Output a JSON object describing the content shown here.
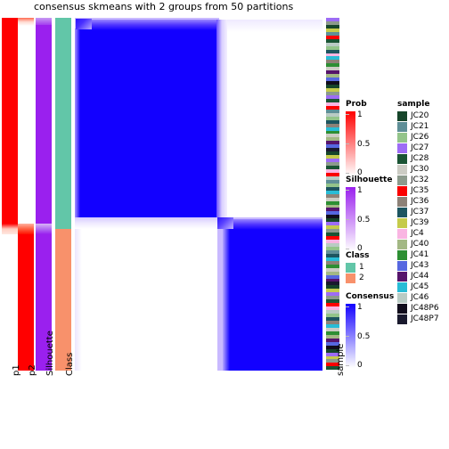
{
  "title": "consensus skmeans with 2 groups from 50 partitions",
  "axis_labels": {
    "p1": "p1",
    "p2": "p2",
    "silhouette": "Silhouette",
    "class": "Class",
    "sample": "sample"
  },
  "legends": {
    "prob": {
      "title": "Prob",
      "type": "gradient",
      "ticks": [
        "1",
        "0.5",
        "0"
      ],
      "high_color": "#ff0000",
      "low_color": "#ffffff"
    },
    "silhouette": {
      "title": "Silhouette",
      "type": "gradient",
      "ticks": [
        "1",
        "0.5",
        "0"
      ],
      "high_color": "#9a20ee",
      "low_color": "#ffffff"
    },
    "class": {
      "title": "Class",
      "type": "discrete",
      "items": [
        {
          "label": "1",
          "color": "#62c6a8"
        },
        {
          "label": "2",
          "color": "#f8916b"
        }
      ]
    },
    "consensus": {
      "title": "Consensus",
      "type": "gradient",
      "ticks": [
        "1",
        "0.5",
        "0"
      ],
      "high_color": "#1200ff",
      "low_color": "#ffffff"
    },
    "sample": {
      "title": "sample",
      "type": "discrete",
      "items": [
        {
          "label": "JC20",
          "color": "#16452a"
        },
        {
          "label": "JC21",
          "color": "#5f8f97"
        },
        {
          "label": "JC26",
          "color": "#93c48a"
        },
        {
          "label": "JC27",
          "color": "#9d6cf5"
        },
        {
          "label": "JC28",
          "color": "#1a5434"
        },
        {
          "label": "JC30",
          "color": "#ccccc4"
        },
        {
          "label": "JC32",
          "color": "#8c9a8c"
        },
        {
          "label": "JC35",
          "color": "#fa0000"
        },
        {
          "label": "JC36",
          "color": "#8d8177"
        },
        {
          "label": "JC37",
          "color": "#1d5560"
        },
        {
          "label": "JC39",
          "color": "#c5cb4b"
        },
        {
          "label": "JC4",
          "color": "#f9b5e2"
        },
        {
          "label": "JC40",
          "color": "#a3b884"
        },
        {
          "label": "JC41",
          "color": "#2d8f33"
        },
        {
          "label": "JC43",
          "color": "#5667e0"
        },
        {
          "label": "JC44",
          "color": "#56146b"
        },
        {
          "label": "JC45",
          "color": "#28bcd6"
        },
        {
          "label": "JC46",
          "color": "#b9cbc4"
        },
        {
          "label": "JC48P6",
          "color": "#110d1c"
        },
        {
          "label": "JC48P7",
          "color": "#1a1a2e"
        }
      ]
    }
  },
  "chart_data": {
    "type": "heatmap",
    "title": "consensus skmeans with 2 groups from 50 partitions",
    "description": "Consensus matrix from skmeans clustering with k=2 over 50 partitions; two diagonal blocks of consensus 1 (blue) with off-diagonal consensus 0 (white).",
    "n_groups": 2,
    "n_partitions": 50,
    "method": "skmeans",
    "value_range": [
      0,
      1
    ],
    "group_split_fraction": 0.6,
    "blocks": [
      {
        "group": 1,
        "row_start": 0.0,
        "row_end": 0.6,
        "col_start": 0.0,
        "col_end": 0.6,
        "value": 1
      },
      {
        "group": 1,
        "row_start": 0.0,
        "row_end": 0.6,
        "col_start": 0.6,
        "col_end": 1.0,
        "value": 0
      },
      {
        "group": 2,
        "row_start": 0.6,
        "row_end": 1.0,
        "col_start": 0.0,
        "col_end": 0.6,
        "value": 0
      },
      {
        "group": 2,
        "row_start": 0.6,
        "row_end": 1.0,
        "col_start": 0.6,
        "col_end": 1.0,
        "value": 1
      }
    ],
    "annotations": {
      "p1": {
        "top_block": 1,
        "bottom_block": 0,
        "colors": [
          "#ff0000",
          "#ffffff"
        ]
      },
      "p2": {
        "top_block": 0,
        "bottom_block": 1,
        "colors": [
          "#ffffff",
          "#ff0000"
        ]
      },
      "silhouette": {
        "top_block": 1,
        "bottom_block": 1,
        "color": "#9a20ee"
      },
      "class": {
        "top_block": 1,
        "bottom_block": 2,
        "colors": [
          "#62c6a8",
          "#f8916b"
        ]
      }
    },
    "sample_strip_colors": [
      "#9d6cf5",
      "#8c9a8c",
      "#16452a",
      "#c5cb4b",
      "#5f8f97",
      "#fa0000",
      "#1a5434",
      "#b9cbc4",
      "#93c48a",
      "#1d5560",
      "#f9b5e2",
      "#28bcd6",
      "#8d8177",
      "#2d8f33",
      "#ccccc4",
      "#56146b",
      "#a3b884",
      "#5667e0",
      "#110d1c",
      "#16452a",
      "#c5cb4b",
      "#8c9a8c",
      "#9d6cf5",
      "#1a5434",
      "#f9b5e2",
      "#fa0000",
      "#5f8f97",
      "#b9cbc4",
      "#93c48a",
      "#1d5560",
      "#8d8177",
      "#28bcd6",
      "#2d8f33",
      "#ccccc4",
      "#a3b884",
      "#56146b",
      "#5667e0",
      "#1a1a2e",
      "#16452a",
      "#c5cb4b",
      "#9d6cf5",
      "#8c9a8c",
      "#1a5434",
      "#f9b5e2",
      "#fa0000",
      "#b9cbc4",
      "#5f8f97",
      "#93c48a",
      "#1d5560",
      "#28bcd6",
      "#8d8177",
      "#ccccc4",
      "#2d8f33",
      "#a3b884",
      "#56146b",
      "#5667e0",
      "#110d1c",
      "#16452a",
      "#9d6cf5",
      "#c5cb4b",
      "#8c9a8c",
      "#1a5434",
      "#fa0000",
      "#f9b5e2",
      "#b9cbc4",
      "#93c48a",
      "#5f8f97",
      "#1d5560",
      "#28bcd6",
      "#8d8177",
      "#2d8f33",
      "#ccccc4",
      "#a3b884",
      "#5667e0",
      "#56146b",
      "#1a1a2e",
      "#16452a",
      "#c5cb4b",
      "#9d6cf5",
      "#8c9a8c",
      "#1a5434",
      "#fa0000",
      "#f9b5e2",
      "#b9cbc4",
      "#93c48a",
      "#1d5560",
      "#8d8177",
      "#28bcd6",
      "#ccccc4",
      "#2d8f33",
      "#a3b884",
      "#56146b",
      "#5667e0",
      "#110d1c",
      "#16452a",
      "#9d6cf5",
      "#c5cb4b",
      "#8c9a8c",
      "#fa0000",
      "#1a5434"
    ]
  }
}
